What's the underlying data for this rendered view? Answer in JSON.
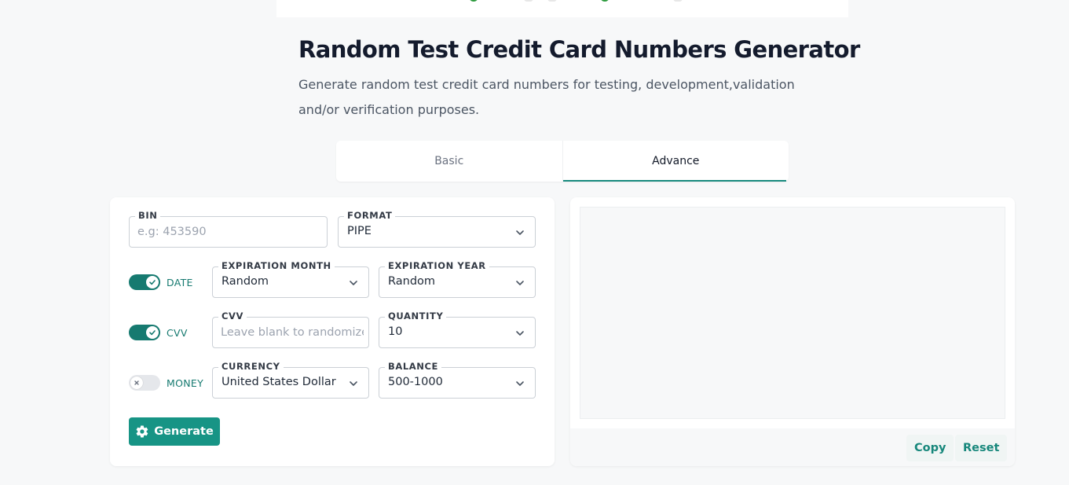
{
  "page": {
    "title": "Random Test Credit Card Numbers Generator",
    "subtitle": "Generate random test credit card numbers for testing, development,validation and/or verification purposes."
  },
  "tabs": [
    {
      "label": "Basic",
      "active": false
    },
    {
      "label": "Advance",
      "active": true
    }
  ],
  "form": {
    "bin": {
      "label": "BIN",
      "value": "",
      "placeholder": "e.g: 453590"
    },
    "format": {
      "label": "FORMAT",
      "value": "PIPE"
    },
    "date_toggle": {
      "label": "DATE",
      "on": true
    },
    "expiration_month": {
      "label": "EXPIRATION MONTH",
      "value": "Random"
    },
    "expiration_year": {
      "label": "EXPIRATION YEAR",
      "value": "Random"
    },
    "cvv_toggle": {
      "label": "CVV",
      "on": true
    },
    "cvv": {
      "label": "CVV",
      "value": "",
      "placeholder": "Leave blank to randomize"
    },
    "quantity": {
      "label": "QUANTITY",
      "value": "10"
    },
    "money_toggle": {
      "label": "MONEY",
      "on": false
    },
    "currency": {
      "label": "CURRENCY",
      "value": "United States Dollar"
    },
    "balance": {
      "label": "BALANCE",
      "value": "500-1000"
    },
    "generate_label": "Generate"
  },
  "output": {
    "text": "",
    "copy_label": "Copy",
    "reset_label": "Reset"
  },
  "icons": {
    "chevron": "chevron-down-icon",
    "check": "check-icon",
    "close": "close-icon",
    "gear": "gear-icon"
  },
  "colors": {
    "accent": "#179485",
    "toggle_on": "#167a70",
    "background": "#f7f8f9"
  }
}
